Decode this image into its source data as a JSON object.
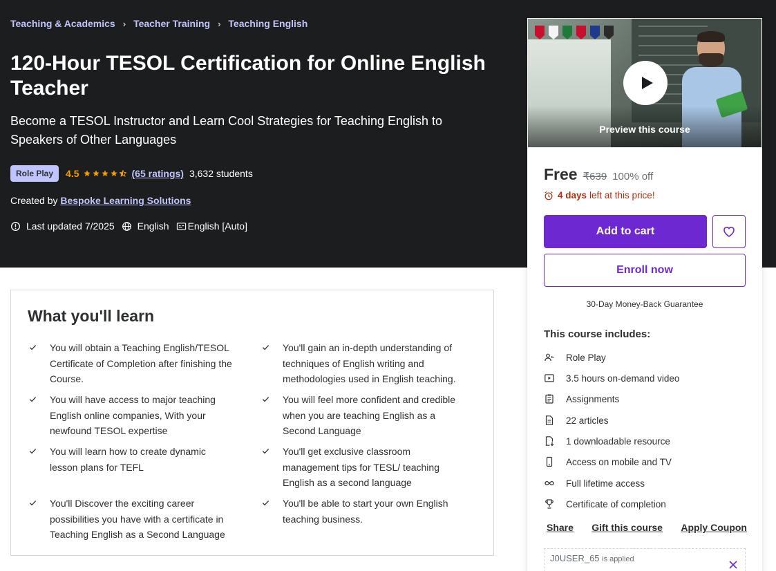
{
  "breadcrumb": [
    "Teaching & Academics",
    "Teacher Training",
    "Teaching English"
  ],
  "course": {
    "title": "120-Hour TESOL Certification for Online English Teacher",
    "subtitle": "Become a TESOL Instructor and Learn Cool Strategies for Teaching English to Speakers of Other Languages",
    "badge": "Role Play",
    "rating": "4.5",
    "stars": 4.5,
    "ratings_count": "(65 ratings)",
    "students": "3,632 students",
    "created_by_label": "Created by",
    "author": "Bespoke Learning Solutions",
    "last_updated": "Last updated 7/2025",
    "language": "English",
    "captions": "English [Auto]"
  },
  "learn": {
    "heading": "What you'll learn",
    "items": [
      "You will obtain a Teaching English/TESOL Certificate of Completion after finishing the Course.",
      "You'll gain an in-depth understanding of techniques of English writing and methodologies used in English teaching.",
      "You will have access to major teaching English online companies, With your newfound TESOL expertise",
      "You will feel more confident and credible when you are teaching English as a Second Language",
      "You will learn how to create dynamic lesson plans for TEFL",
      "You'll get exclusive classroom management tips for TESL/ teaching English as a second language",
      "You'll Discover the exciting career possibilities you have with a certificate in Teaching English as a Second Language",
      "You'll be able to start your own English teaching business."
    ]
  },
  "sidebar": {
    "preview_label": "Preview this course",
    "price": "Free",
    "original_price": "₹639",
    "discount": "100% off",
    "timer_bold": "4 days",
    "timer_rest": "left at this price!",
    "add_to_cart": "Add to cart",
    "enroll": "Enroll now",
    "guarantee": "30-Day Money-Back Guarantee",
    "includes_title": "This course includes:",
    "includes": [
      {
        "icon": "role-play-icon",
        "label": "Role Play"
      },
      {
        "icon": "video-icon",
        "label": "3.5 hours on-demand video"
      },
      {
        "icon": "assignments-icon",
        "label": "Assignments"
      },
      {
        "icon": "article-icon",
        "label": "22 articles"
      },
      {
        "icon": "download-icon",
        "label": "1 downloadable resource"
      },
      {
        "icon": "mobile-icon",
        "label": "Access on mobile and TV"
      },
      {
        "icon": "infinity-icon",
        "label": "Full lifetime access"
      },
      {
        "icon": "trophy-icon",
        "label": "Certificate of completion"
      }
    ],
    "share": "Share",
    "gift": "Gift this course",
    "coupon_link": "Apply Coupon",
    "coupon_code": "J0USER_65",
    "coupon_applied": "is applied"
  },
  "colors": {
    "header_bg": "#1c1d1f",
    "accent": "#6d28d2",
    "link": "#c0c4fc",
    "rating": "#f69c08",
    "timer": "#b32d0f"
  }
}
